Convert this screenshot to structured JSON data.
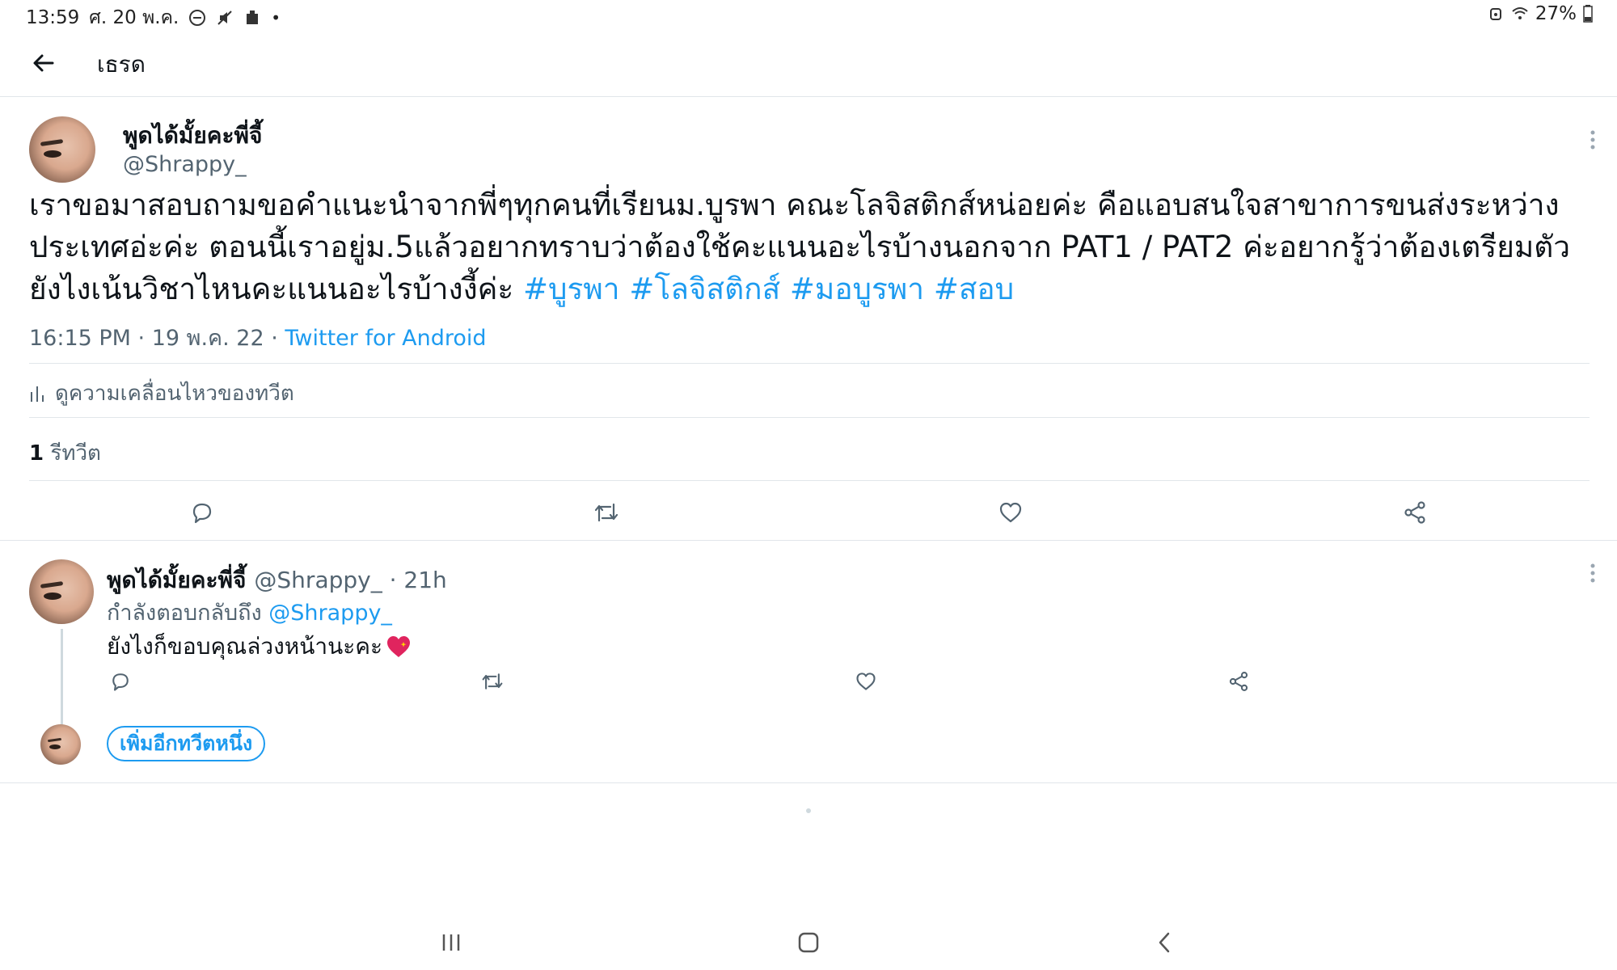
{
  "status_bar": {
    "time": "13:59",
    "date": "ศ. 20 พ.ค.",
    "battery": "27%"
  },
  "header": {
    "title": "เธรด"
  },
  "main_tweet": {
    "name": "พูดได้มั้ยคะพี่จี้",
    "handle": "@Shrappy_",
    "text": "เราขอมาสอบถามขอคำแนะนำจากพี่ๆทุกคนที่เรียนม.บูรพา คณะโลจิสติกส์หน่อยค่ะ คือแอบสนใจสาขาการขนส่งระหว่างประเทศอ่ะค่ะ ตอนนี้เราอยู่ม.5แล้วอยากทราบว่าต้องใช้คะแนนอะไรบ้างนอกจาก PAT1 / PAT2 ค่ะอยากรู้ว่าต้องเตรียมตัวยังไงเน้นวิชาไหนคะแนนอะไรบ้างงี้ค่ะ ",
    "hashtags": [
      "#บูรพา",
      "#โลจิสติกส์",
      "#มอบูรพา",
      "#สอบ"
    ],
    "timestamp": "16:15 PM · 19 พ.ค. 22 · ",
    "source": "Twitter for Android",
    "analytics_label": "ดูความเคลื่อนไหวของทวีต",
    "retweet_count": "1",
    "retweet_label": " รีทวีต"
  },
  "reply": {
    "name": "พูดได้มั้ยคะพี่จี้",
    "handle": "@Shrappy_ · 21h",
    "replying_to_label": "กำลังตอบกลับถึง ",
    "replying_to_mention": "@Shrappy_",
    "text": "ยังไงก็ขอบคุณล่วงหน้านะคะ"
  },
  "add_tweet_label": "เพิ่มอีกทวีตหนึ่ง",
  "colors": {
    "accent": "#1d9bf0",
    "text": "#0f1419",
    "muted": "#536471",
    "divider": "#e1e6ea"
  },
  "icons": [
    "back-arrow-icon",
    "more-icon",
    "analytics-icon",
    "reply-icon",
    "retweet-icon",
    "like-icon",
    "share-icon",
    "heart-emoji-icon",
    "recents-icon",
    "home-icon",
    "back-nav-icon"
  ]
}
